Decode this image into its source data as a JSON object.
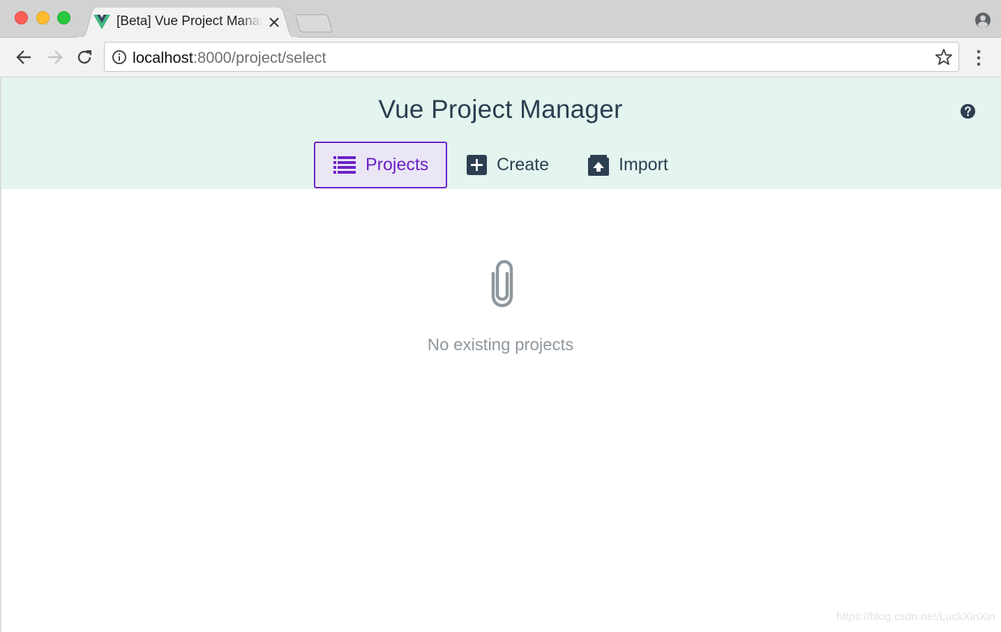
{
  "browser": {
    "tab_title": "[Beta] Vue Project Manager",
    "close_label": "×",
    "url_host": "localhost",
    "url_rest": ":8000/project/select"
  },
  "app": {
    "title": "Vue Project Manager",
    "nav": [
      {
        "label": "Projects",
        "icon": "list-icon",
        "active": true
      },
      {
        "label": "Create",
        "icon": "plus-box-icon",
        "active": false
      },
      {
        "label": "Import",
        "icon": "upload-box-icon",
        "active": false
      }
    ]
  },
  "empty_state": {
    "icon": "paperclip-icon",
    "message": "No existing projects"
  },
  "watermark": "https://blog.csdn.net/LuckXinXin",
  "colors": {
    "header_bg": "#e4f5ef",
    "accent": "#6b1fc7",
    "text_dark": "#2c3e50",
    "text_muted": "#8e979e"
  }
}
